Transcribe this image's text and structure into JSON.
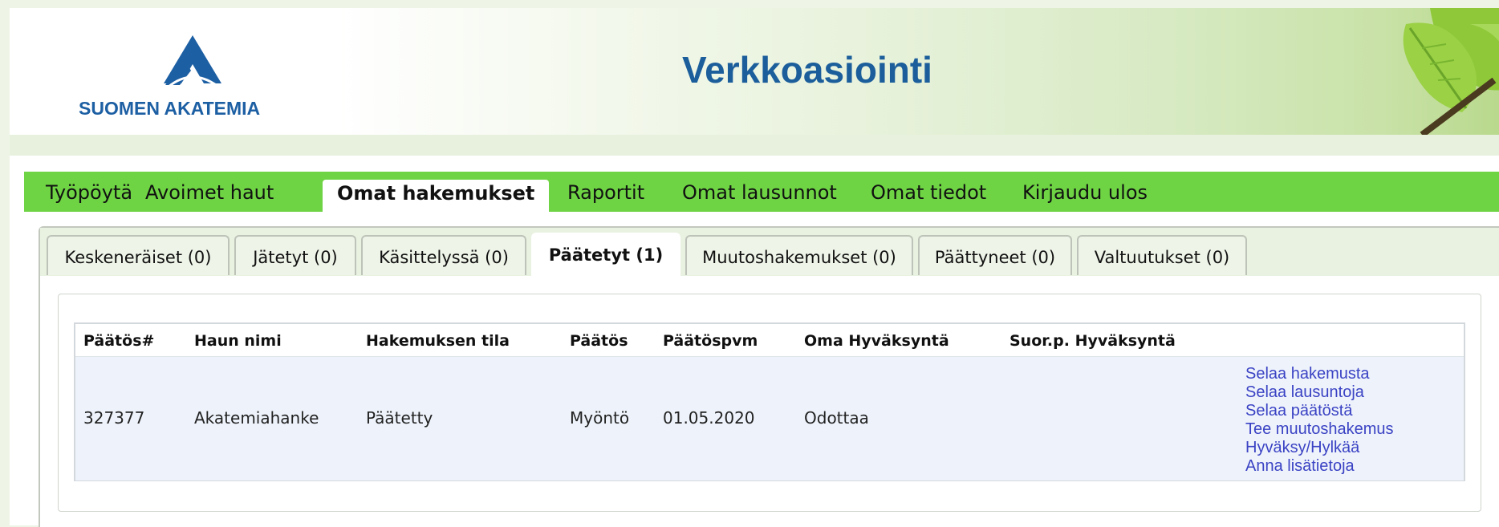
{
  "header": {
    "logo_text": "SUOMEN AKATEMIA",
    "title": "Verkkoasiointi"
  },
  "main_nav": {
    "items": [
      {
        "label": "Työpöytä"
      },
      {
        "label": "Avoimet haut"
      },
      {
        "label": "Omat hakemukset",
        "active": true
      },
      {
        "label": "Raportit"
      },
      {
        "label": "Omat lausunnot"
      },
      {
        "label": "Omat tiedot"
      },
      {
        "label": "Kirjaudu ulos"
      }
    ]
  },
  "sub_tabs": {
    "items": [
      {
        "label": "Keskeneräiset (0)"
      },
      {
        "label": "Jätetyt (0)"
      },
      {
        "label": "Käsittelyssä (0)"
      },
      {
        "label": "Päätetyt (1)",
        "active": true
      },
      {
        "label": "Muutoshakemukset (0)"
      },
      {
        "label": "Päättyneet (0)"
      },
      {
        "label": "Valtuutukset (0)"
      }
    ]
  },
  "table": {
    "columns": [
      "Päätös#",
      "Haun nimi",
      "Hakemuksen tila",
      "Päätös",
      "Päätöspvm",
      "Oma Hyväksyntä",
      "Suor.p. Hyväksyntä"
    ],
    "rows": [
      {
        "cells": [
          "327377",
          "Akatemiahanke",
          "Päätetty",
          "Myöntö",
          "01.05.2020",
          "Odottaa",
          ""
        ],
        "actions": [
          "Selaa hakemusta",
          "Selaa lausuntoja",
          "Selaa päätöstä",
          "Tee muutoshakemus",
          "Hyväksy/Hylkää",
          "Anna lisätietoja"
        ]
      }
    ]
  },
  "colors": {
    "nav_green": "#6ed444",
    "title_blue": "#1b5e9b",
    "link_blue": "#3b43c4"
  }
}
